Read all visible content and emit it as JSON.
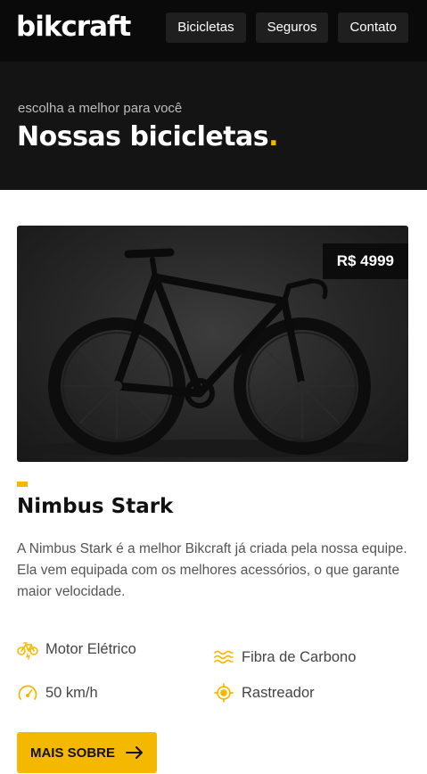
{
  "header": {
    "logo": "bikcraft",
    "nav": [
      {
        "label": "Bicicletas"
      },
      {
        "label": "Seguros"
      },
      {
        "label": "Contato"
      }
    ]
  },
  "hero": {
    "subtitle": "escolha a melhor para você",
    "title": "Nossas bicicletas",
    "title_dot": "."
  },
  "product": {
    "image_icon": "road-bike-photo",
    "price": "R$ 4999",
    "name": "Nimbus Stark",
    "description": "A Nimbus Stark é a melhor Bikcraft já criada pela nossa equipe. Ela vem equipada com os melhores acessórios, o que garante maior velocidade.",
    "features": [
      {
        "label": "Motor Elétrico",
        "icon": "electric-bike-icon"
      },
      {
        "label": "Fibra de Carbono",
        "icon": "carbon-fiber-icon"
      },
      {
        "label": "50 km/h",
        "icon": "speedometer-icon"
      },
      {
        "label": "Rastreador",
        "icon": "gps-tracker-icon"
      }
    ],
    "cta_label": "MAIS SOBRE",
    "cta_icon": "arrow-right-icon"
  },
  "colors": {
    "accent": "#f5b800",
    "header_bg": "#0a0a0a",
    "hero_bg": "#141414"
  }
}
